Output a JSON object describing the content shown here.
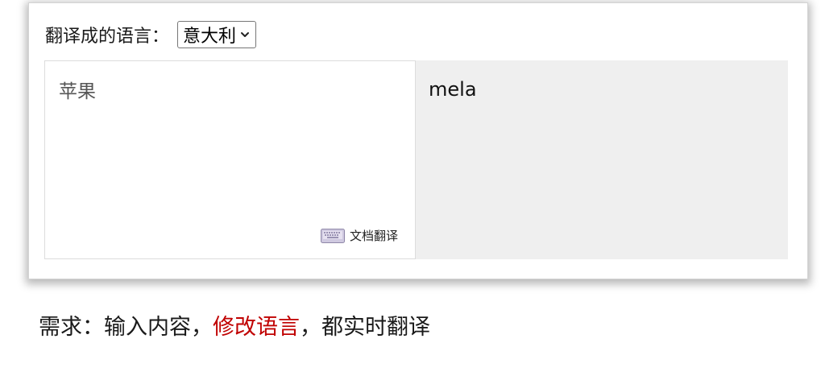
{
  "translator": {
    "lang_label": "翻译成的语言：",
    "selected_language": "意大利",
    "source_text": "苹果",
    "doc_translate_label": "文档翻译",
    "output_text": "mela"
  },
  "caption": {
    "prefix": "需求：输入内容，",
    "highlight": "修改语言",
    "suffix": "，都实时翻译"
  },
  "colors": {
    "highlight": "#c00000",
    "output_bg": "#efefef"
  },
  "icons": {
    "select_arrow": "chevron-down-icon",
    "doc_translate": "keyboard-icon"
  }
}
